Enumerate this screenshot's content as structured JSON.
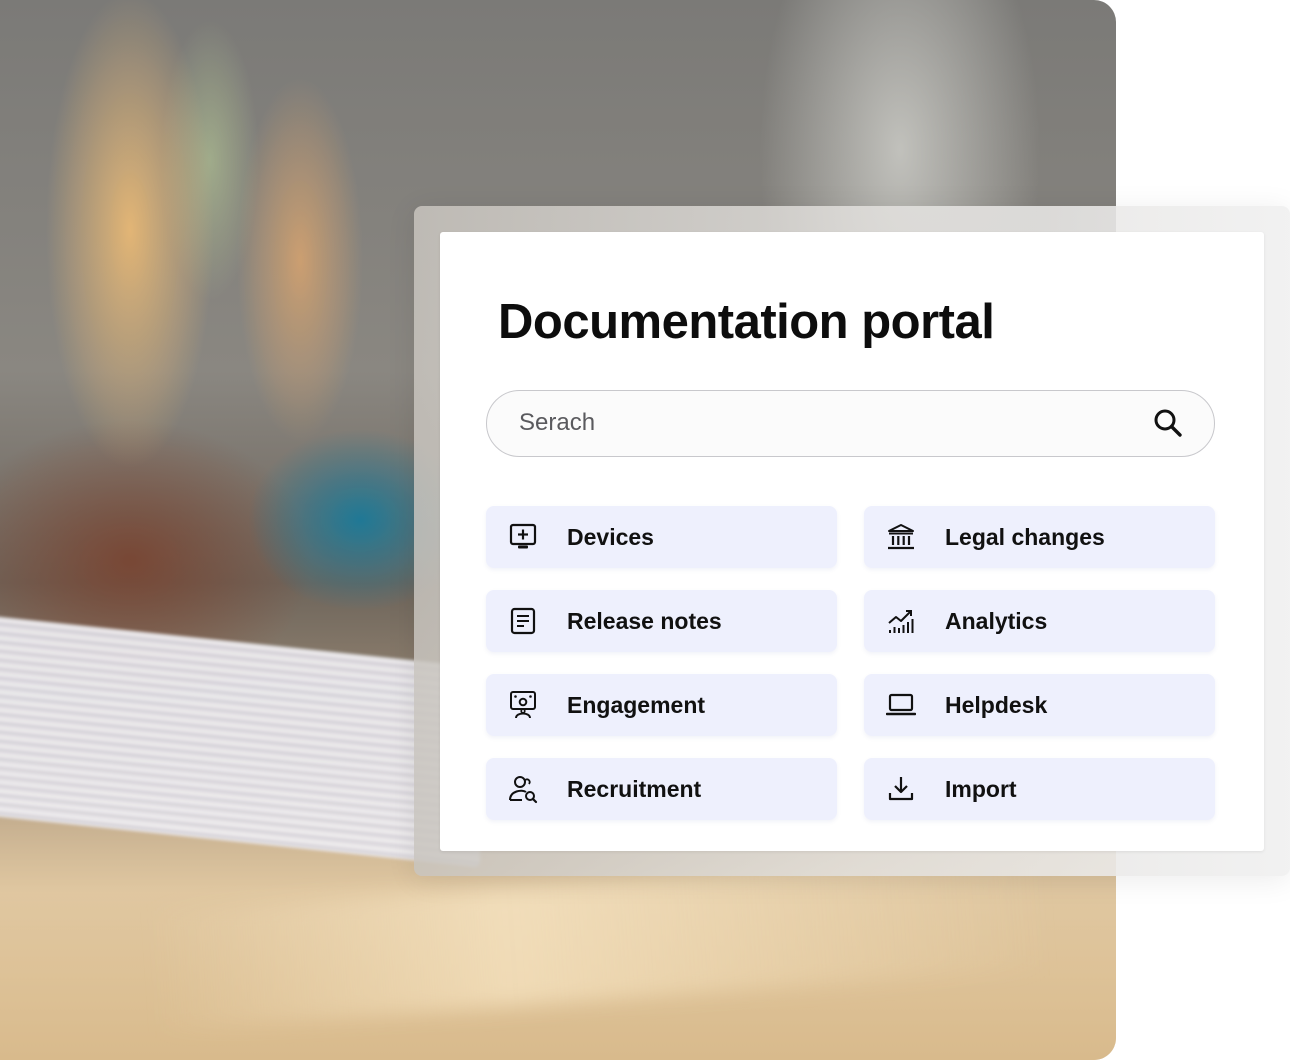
{
  "portal": {
    "title": "Documentation portal",
    "search": {
      "placeholder": "Serach",
      "icon": "search-icon"
    },
    "tiles": [
      {
        "label": "Devices",
        "icon": "monitor-plus-icon"
      },
      {
        "label": "Legal changes",
        "icon": "bank-building-icon"
      },
      {
        "label": "Release notes",
        "icon": "document-lines-icon"
      },
      {
        "label": "Analytics",
        "icon": "chart-trend-icon"
      },
      {
        "label": "Engagement",
        "icon": "presentation-user-icon"
      },
      {
        "label": "Helpdesk",
        "icon": "laptop-icon"
      },
      {
        "label": "Recruitment",
        "icon": "user-search-icon"
      },
      {
        "label": "Import",
        "icon": "download-icon"
      }
    ]
  },
  "colors": {
    "tile_background": "#eef0fd",
    "title_text": "#0d0d0d",
    "search_border": "#c8c8cc"
  }
}
